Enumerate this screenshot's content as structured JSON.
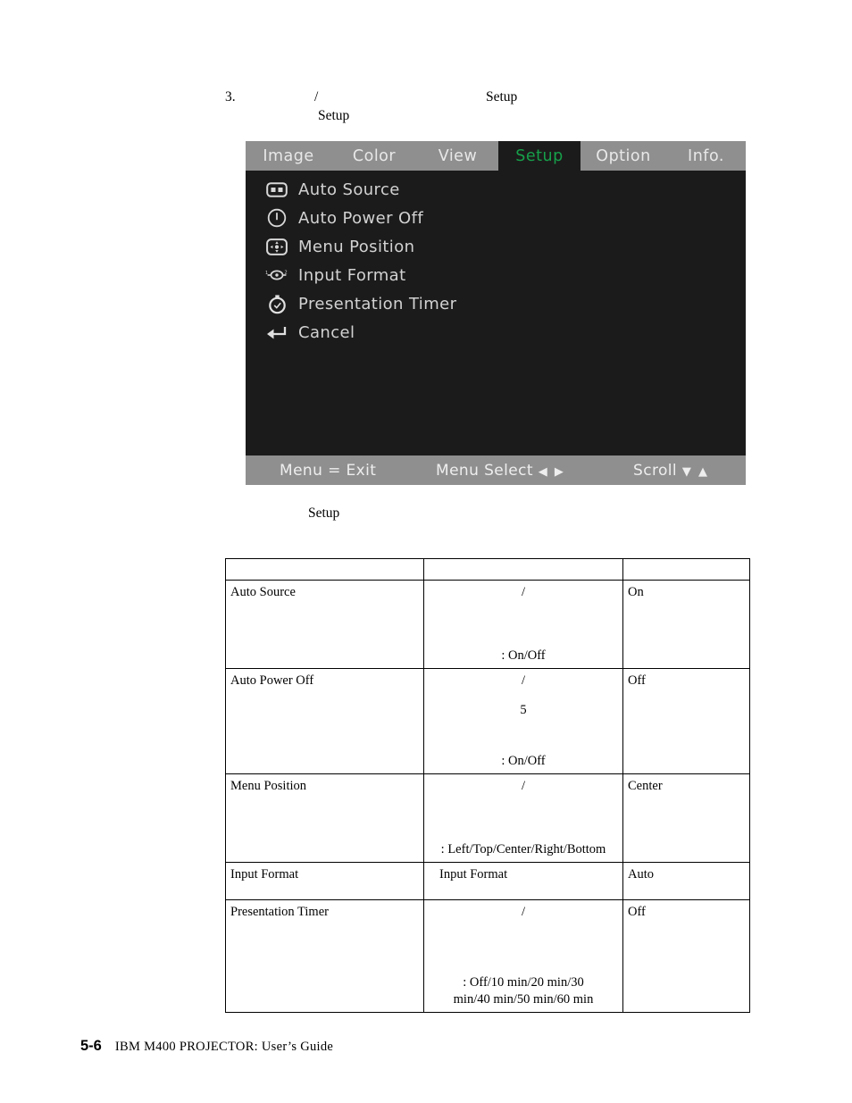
{
  "step": {
    "number": "3.",
    "segment_a": "/",
    "segment_b": "Setup",
    "line2": "Setup"
  },
  "osd": {
    "active_tab": "Setup",
    "accent_color": "#16a04a",
    "panel_bg": "#1c1b1b",
    "bar_bg": "#8f8f8f",
    "text_color": "#d2d2d2",
    "tabs": [
      {
        "label": "Image",
        "icon": "tab-image"
      },
      {
        "label": "Color",
        "icon": "tab-color"
      },
      {
        "label": "View",
        "icon": "tab-view"
      },
      {
        "label": "Setup",
        "icon": "tab-setup"
      },
      {
        "label": "Option",
        "icon": "tab-option"
      },
      {
        "label": "Info.",
        "icon": "tab-info"
      }
    ],
    "items": [
      {
        "label": "Auto Source",
        "icon": "auto-source-icon"
      },
      {
        "label": "Auto Power Off",
        "icon": "power-off-icon"
      },
      {
        "label": "Menu Position",
        "icon": "menu-position-icon"
      },
      {
        "label": "Input Format",
        "icon": "input-format-icon"
      },
      {
        "label": "Presentation Timer",
        "icon": "timer-icon"
      },
      {
        "label": "Cancel",
        "icon": "return-arrow-icon"
      }
    ],
    "footer": {
      "exit": "Menu = Exit",
      "select": "Menu Select",
      "select_arrows": "◀ ▶",
      "scroll": "Scroll",
      "scroll_arrows": "▼ ▲"
    }
  },
  "caption": "Setup",
  "table": {
    "headers": [
      "",
      "",
      ""
    ],
    "rows": [
      {
        "name": "Auto  Source",
        "desc_top": "/",
        "desc_options": ":  On/Off",
        "default": "On"
      },
      {
        "name": "Auto  Power  Off",
        "desc_top": "/",
        "desc_mid": "5",
        "desc_options": ":  On/Off",
        "default": "Off"
      },
      {
        "name": "Menu  Position",
        "desc_top": "/",
        "desc_options": ":  Left/Top/Center/Right/Bottom",
        "default": "Center"
      },
      {
        "name": "Input  Format",
        "desc_top": "Input  Format",
        "default": "Auto"
      },
      {
        "name": "Presentation  Timer",
        "desc_top": "/",
        "desc_options": ":  Off/10  min/20  min/30",
        "desc_options2": "min/40  min/50  min/60  min",
        "default": "Off"
      }
    ]
  },
  "footer": {
    "page": "5-6",
    "text": "IBM  M400  PROJECTOR:  User’s  Guide"
  }
}
